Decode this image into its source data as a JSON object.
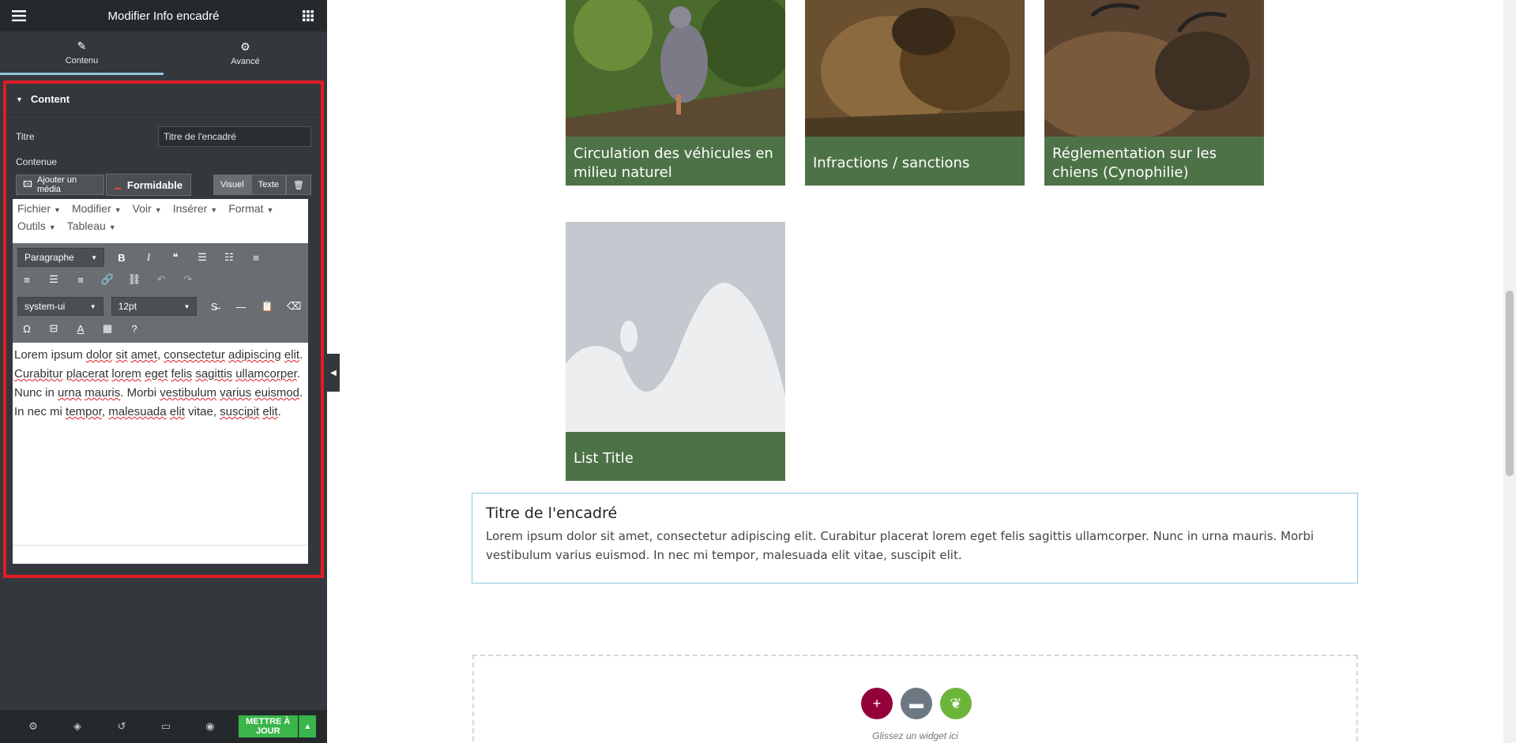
{
  "panel": {
    "title": "Modifier Info encadré",
    "tabs": [
      {
        "label": "Contenu",
        "icon": "pencil-icon"
      },
      {
        "label": "Avancé",
        "icon": "gear-icon"
      }
    ],
    "section_title": "Content",
    "titre_label": "Titre",
    "titre_value": "Titre de l'encadré",
    "contenue_label": "Contenue",
    "add_media": "Ajouter un média",
    "formidable": "Formidable",
    "visuel": "Visuel",
    "texte": "Texte",
    "menus": [
      "Fichier",
      "Modifier",
      "Voir",
      "Insérer",
      "Format",
      "Outils",
      "Tableau"
    ],
    "paragraph_select": "Paragraphe",
    "font_select": "system-ui",
    "size_select": "12pt",
    "content_words": [
      {
        "t": "Lorem ipsum ",
        "s": false
      },
      {
        "t": "dolor",
        "s": true
      },
      {
        "t": " ",
        "s": false
      },
      {
        "t": "sit",
        "s": true
      },
      {
        "t": " ",
        "s": false
      },
      {
        "t": "amet",
        "s": true
      },
      {
        "t": ", ",
        "s": false
      },
      {
        "t": "consectetur",
        "s": true
      },
      {
        "t": " ",
        "s": false
      },
      {
        "t": "adipiscing",
        "s": true
      },
      {
        "t": " ",
        "s": false
      },
      {
        "t": "elit",
        "s": true
      },
      {
        "t": ". ",
        "s": false
      },
      {
        "t": "Curabitur",
        "s": true
      },
      {
        "t": " ",
        "s": false
      },
      {
        "t": "placerat",
        "s": true
      },
      {
        "t": " ",
        "s": false
      },
      {
        "t": "lorem",
        "s": true
      },
      {
        "t": " ",
        "s": false
      },
      {
        "t": "eget",
        "s": true
      },
      {
        "t": " ",
        "s": false
      },
      {
        "t": "felis",
        "s": true
      },
      {
        "t": " ",
        "s": false
      },
      {
        "t": "sagittis",
        "s": true
      },
      {
        "t": " ",
        "s": false
      },
      {
        "t": "ullamcorper",
        "s": true
      },
      {
        "t": ". Nunc in ",
        "s": false
      },
      {
        "t": "urna",
        "s": true
      },
      {
        "t": " ",
        "s": false
      },
      {
        "t": "mauris",
        "s": true
      },
      {
        "t": ". Morbi ",
        "s": false
      },
      {
        "t": "vestibulum",
        "s": true
      },
      {
        "t": " ",
        "s": false
      },
      {
        "t": "varius",
        "s": true
      },
      {
        "t": " ",
        "s": false
      },
      {
        "t": "euismod",
        "s": true
      },
      {
        "t": ". In nec mi ",
        "s": false
      },
      {
        "t": "tempor",
        "s": true
      },
      {
        "t": ", ",
        "s": false
      },
      {
        "t": "malesuada",
        "s": true
      },
      {
        "t": " ",
        "s": false
      },
      {
        "t": "elit",
        "s": true
      },
      {
        "t": " vitae, ",
        "s": false
      },
      {
        "t": "suscipit",
        "s": true
      },
      {
        "t": " ",
        "s": false
      },
      {
        "t": "elit",
        "s": true
      },
      {
        "t": ".",
        "s": false
      }
    ],
    "update_button": "METTRE À JOUR",
    "accent": "#93c6e0",
    "highlight_border": "#e01b24",
    "update_color": "#39b54a"
  },
  "preview": {
    "cards": [
      {
        "caption": "Circulation des véhicules en milieu naturel",
        "image": "pigeon-photo"
      },
      {
        "caption": "Infractions / sanctions",
        "image": "marmots-photo"
      },
      {
        "caption": "Réglementation sur les chiens (Cynophilie)",
        "image": "chamois-photo"
      },
      {
        "caption": "List Title",
        "image": "placeholder-image"
      }
    ],
    "card_color": "#4e7247",
    "infobox": {
      "title": "Titre de l'encadré",
      "text": "Lorem ipsum dolor sit amet, consectetur adipiscing elit. Curabitur placerat lorem eget felis sagittis ullamcorper. Nunc in urna mauris. Morbi vestibulum varius euismod. In nec mi tempor, malesuada elit vitae, suscipit elit."
    },
    "dropzone_text": "Glissez un widget ici",
    "dropzone_colors": [
      "#93003a",
      "#6d7882",
      "#6bb53a"
    ]
  }
}
